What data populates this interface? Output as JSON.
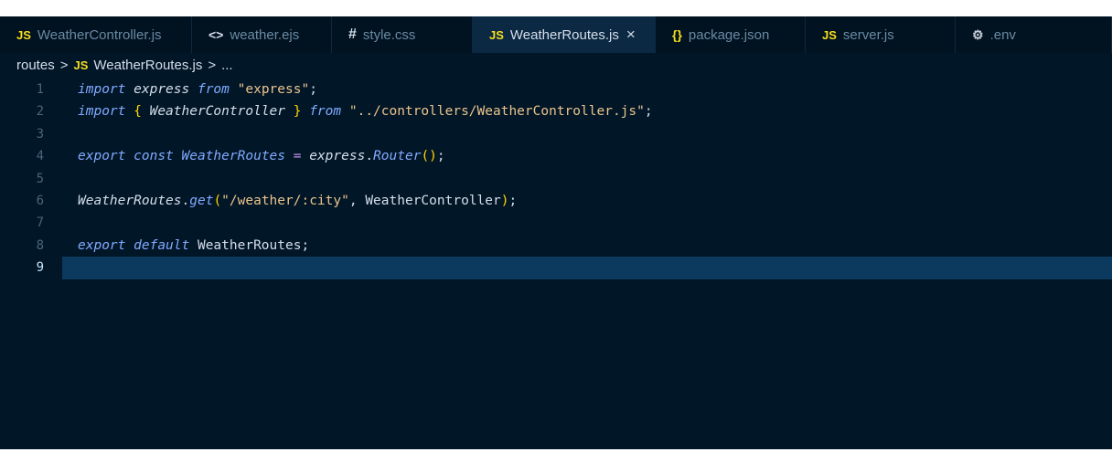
{
  "tabs": [
    {
      "icon": "js-file-icon",
      "glyph": "JS",
      "label": "WeatherController.js",
      "active": false,
      "width": 210
    },
    {
      "icon": "ejs-file-icon",
      "glyph": "<>",
      "label": "weather.ejs",
      "active": false,
      "width": 153
    },
    {
      "icon": "css-file-icon",
      "glyph": "#",
      "label": "style.css",
      "active": false,
      "width": 154
    },
    {
      "icon": "js-file-icon",
      "glyph": "JS",
      "label": "WeatherRoutes.js",
      "active": true,
      "close": "×",
      "width": 200
    },
    {
      "icon": "json-file-icon",
      "glyph": "{}",
      "label": "package.json",
      "active": false,
      "width": 164
    },
    {
      "icon": "js-file-icon",
      "glyph": "JS",
      "label": "server.js",
      "active": false,
      "width": 164
    },
    {
      "icon": "gear-icon",
      "glyph": "⚙",
      "label": ".env",
      "active": false,
      "width": 171
    }
  ],
  "breadcrumb": {
    "folder": "routes",
    "sep1": ">",
    "file_glyph": "JS",
    "file": "WeatherRoutes.js",
    "sep2": ">",
    "more": "..."
  },
  "editor": {
    "current_line": 9,
    "lines": [
      {
        "num": "1",
        "tokens": [
          [
            "kw2",
            "import"
          ],
          [
            "punc",
            " "
          ],
          [
            "id",
            "express"
          ],
          [
            "punc",
            " "
          ],
          [
            "kw2",
            "from"
          ],
          [
            "punc",
            " "
          ],
          [
            "str",
            "\"express\""
          ],
          [
            "punc",
            ";"
          ]
        ]
      },
      {
        "num": "2",
        "tokens": [
          [
            "kw2",
            "import"
          ],
          [
            "punc",
            " "
          ],
          [
            "brace",
            "{"
          ],
          [
            "punc",
            " "
          ],
          [
            "id",
            "WeatherController"
          ],
          [
            "punc",
            " "
          ],
          [
            "brace",
            "}"
          ],
          [
            "punc",
            " "
          ],
          [
            "kw2",
            "from"
          ],
          [
            "punc",
            " "
          ],
          [
            "str",
            "\"../controllers/WeatherController.js\""
          ],
          [
            "punc",
            ";"
          ]
        ]
      },
      {
        "num": "3",
        "tokens": []
      },
      {
        "num": "4",
        "tokens": [
          [
            "kw2",
            "export"
          ],
          [
            "punc",
            " "
          ],
          [
            "kw2",
            "const"
          ],
          [
            "punc",
            " "
          ],
          [
            "fn",
            "WeatherRoutes"
          ],
          [
            "punc",
            " "
          ],
          [
            "op",
            "="
          ],
          [
            "punc",
            " "
          ],
          [
            "id",
            "express"
          ],
          [
            "punc",
            "."
          ],
          [
            "fn",
            "Router"
          ],
          [
            "brace",
            "()"
          ],
          [
            "punc",
            ";"
          ]
        ]
      },
      {
        "num": "5",
        "tokens": []
      },
      {
        "num": "6",
        "tokens": [
          [
            "id",
            "WeatherRoutes"
          ],
          [
            "punc",
            "."
          ],
          [
            "fn",
            "get"
          ],
          [
            "brace",
            "("
          ],
          [
            "str",
            "\"/weather/:city\""
          ],
          [
            "punc",
            ", "
          ],
          [
            "ids",
            "WeatherController"
          ],
          [
            "brace",
            ")"
          ],
          [
            "punc",
            ";"
          ]
        ]
      },
      {
        "num": "7",
        "tokens": []
      },
      {
        "num": "8",
        "tokens": [
          [
            "kw2",
            "export"
          ],
          [
            "punc",
            " "
          ],
          [
            "kw2",
            "default"
          ],
          [
            "punc",
            " "
          ],
          [
            "ids",
            "WeatherRoutes"
          ],
          [
            "punc",
            ";"
          ]
        ]
      },
      {
        "num": "9",
        "tokens": []
      }
    ]
  },
  "colors": {
    "editor_bg": "#011627",
    "tabbar_bg": "#011220",
    "active_tab_bg": "#0b2942",
    "current_line_bg": "#0b3a5e",
    "js_icon": "#f7df1e",
    "string": "#ecc48d",
    "keyword": "#82aaff",
    "brace": "#ffd700"
  }
}
